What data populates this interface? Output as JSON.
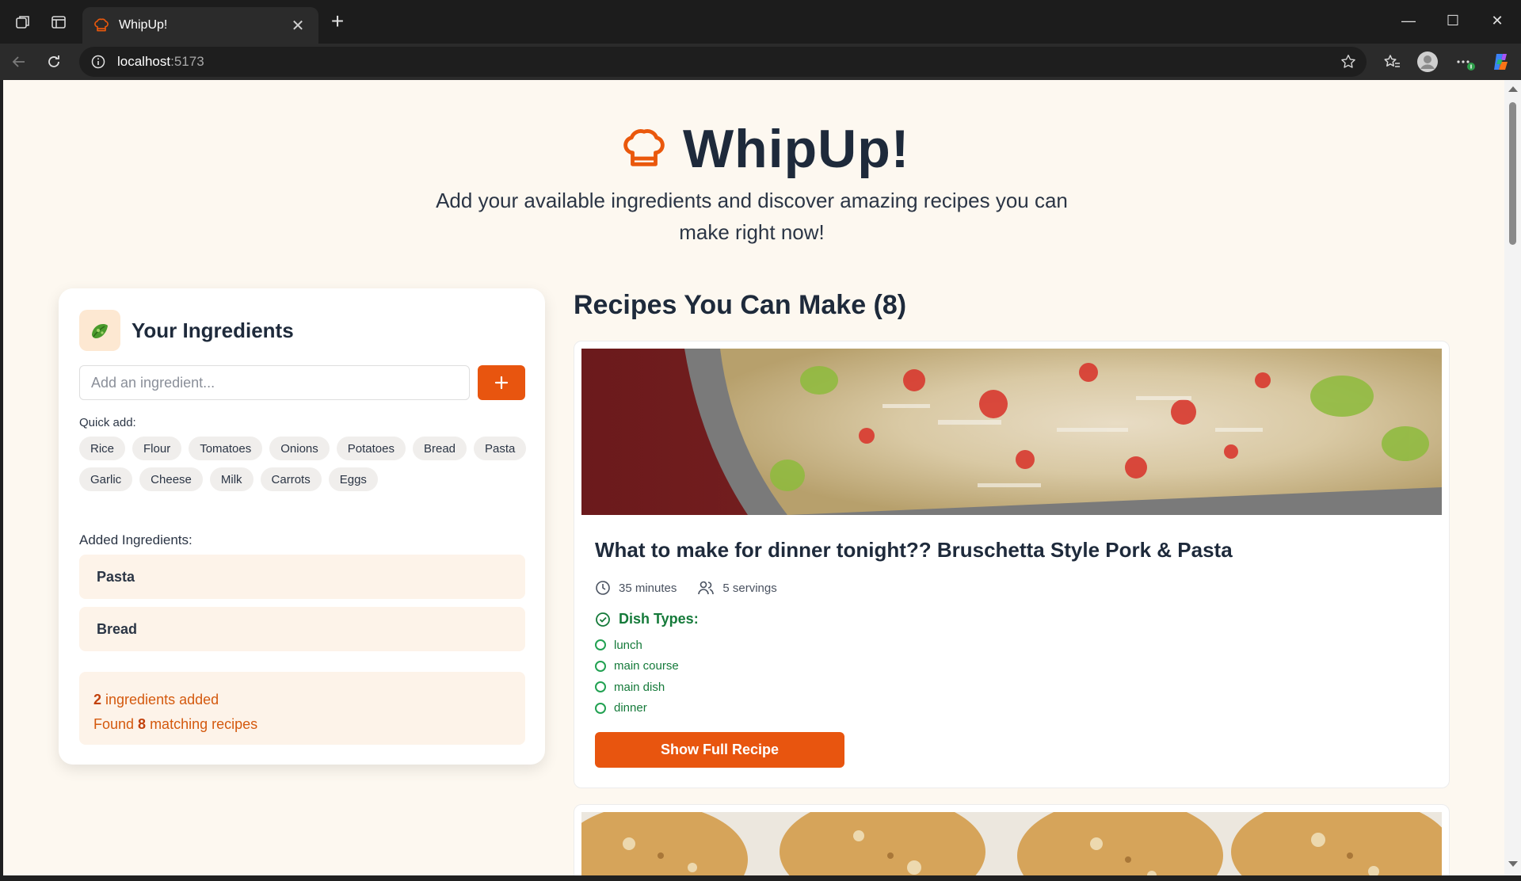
{
  "browser": {
    "tab_title": "WhipUp!",
    "url_host": "localhost",
    "url_port": ":5173"
  },
  "hero": {
    "title": "WhipUp!",
    "tagline": "Add your available ingredients and discover amazing recipes you can make right now!"
  },
  "ingredients_panel": {
    "title": "Your Ingredients",
    "input_placeholder": "Add an ingredient...",
    "add_button_icon": "plus-icon",
    "quick_add_label": "Quick add:",
    "quick_add_row1": [
      "Rice",
      "Flour",
      "Tomatoes",
      "Onions",
      "Potatoes",
      "Bread",
      "Pasta"
    ],
    "quick_add_row2": [
      "Garlic",
      "Cheese",
      "Milk",
      "Carrots",
      "Eggs"
    ],
    "added_label": "Added Ingredients:",
    "added": [
      "Pasta",
      "Bread"
    ],
    "summary": {
      "count": "2",
      "count_suffix": " ingredients added",
      "found_prefix": "Found ",
      "found_count": "8",
      "found_suffix": " matching recipes"
    }
  },
  "recipes": {
    "heading": "Recipes You Can Make (8)",
    "cards": [
      {
        "title": "What to make for dinner tonight?? Bruschetta Style Pork & Pasta",
        "time": "35 minutes",
        "servings": "5 servings",
        "dish_types_label": "Dish Types:",
        "dish_types": [
          "lunch",
          "main course",
          "main dish",
          "dinner"
        ],
        "button": "Show Full Recipe"
      }
    ]
  },
  "colors": {
    "accent": "#e8550f",
    "page_bg": "#fdf8f0",
    "heading": "#1e2a3b",
    "dish_green": "#157a3a"
  }
}
